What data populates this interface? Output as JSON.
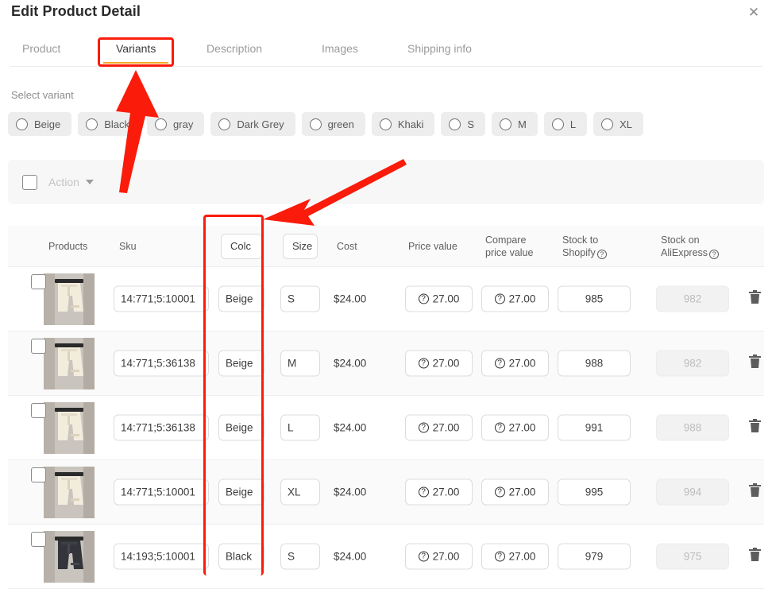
{
  "modal": {
    "title": "Edit Product Detail",
    "close_icon": "close-icon"
  },
  "tabs": [
    {
      "label": "Product",
      "active": false
    },
    {
      "label": "Variants",
      "active": true
    },
    {
      "label": "Description",
      "active": false
    },
    {
      "label": "Images",
      "active": false
    },
    {
      "label": "Shipping info",
      "active": false
    }
  ],
  "variant_selector": {
    "label": "Select variant",
    "chips": [
      {
        "label": "Beige"
      },
      {
        "label": "Black"
      },
      {
        "label": "gray"
      },
      {
        "label": "Dark Grey"
      },
      {
        "label": "green"
      },
      {
        "label": "Khaki"
      },
      {
        "label": "S"
      },
      {
        "label": "M"
      },
      {
        "label": "L"
      },
      {
        "label": "XL"
      }
    ]
  },
  "action_bar": {
    "select_all_checked": false,
    "action_label": "Action",
    "caret_icon": "chevron-down-icon"
  },
  "table": {
    "headers": {
      "products": "Products",
      "sku": "Sku",
      "color": "Colc",
      "color_full": "Color",
      "size": "Size",
      "cost": "Cost",
      "price_value": "Price value",
      "compare_price_value_line1": "Compare",
      "compare_price_value_line2": "price value",
      "stock_to_shopify_line1": "Stock to",
      "stock_to_shopify_line2": "Shopify",
      "stock_on_aliexpress_line1": "Stock on",
      "stock_on_aliexpress_line2": "AliExpress",
      "help_icon": "help-icon"
    },
    "rows": [
      {
        "thumb": "beige-shorts-thumbnail",
        "sku": "14:771;5:10001",
        "color": "Beige",
        "size": "S",
        "cost": "$24.00",
        "price_value": "27.00",
        "compare_price_value": "27.00",
        "stock_to_shopify": "985",
        "stock_on_aliexpress": "982",
        "delete_icon": "trash-icon"
      },
      {
        "thumb": "beige-shorts-thumbnail",
        "sku": "14:771;5:36138",
        "color": "Beige",
        "size": "M",
        "cost": "$24.00",
        "price_value": "27.00",
        "compare_price_value": "27.00",
        "stock_to_shopify": "988",
        "stock_on_aliexpress": "982",
        "delete_icon": "trash-icon"
      },
      {
        "thumb": "beige-shorts-thumbnail",
        "sku": "14:771;5:36138",
        "color": "Beige",
        "size": "L",
        "cost": "$24.00",
        "price_value": "27.00",
        "compare_price_value": "27.00",
        "stock_to_shopify": "991",
        "stock_on_aliexpress": "988",
        "delete_icon": "trash-icon"
      },
      {
        "thumb": "beige-shorts-thumbnail",
        "sku": "14:771;5:10001",
        "color": "Beige",
        "size": "XL",
        "cost": "$24.00",
        "price_value": "27.00",
        "compare_price_value": "27.00",
        "stock_to_shopify": "995",
        "stock_on_aliexpress": "994",
        "delete_icon": "trash-icon"
      },
      {
        "thumb": "black-shorts-thumbnail",
        "sku": "14:193;5:10001",
        "color": "Black",
        "size": "S",
        "cost": "$24.00",
        "price_value": "27.00",
        "compare_price_value": "27.00",
        "stock_to_shopify": "979",
        "stock_on_aliexpress": "975",
        "delete_icon": "trash-icon"
      }
    ]
  },
  "annotations": {
    "color": "#fb1b0a",
    "highlight_variants_tab": true,
    "highlight_color_column": true,
    "arrow_to_variants_tab": "arrow-up",
    "arrow_to_color_column": "arrow-down-left"
  }
}
